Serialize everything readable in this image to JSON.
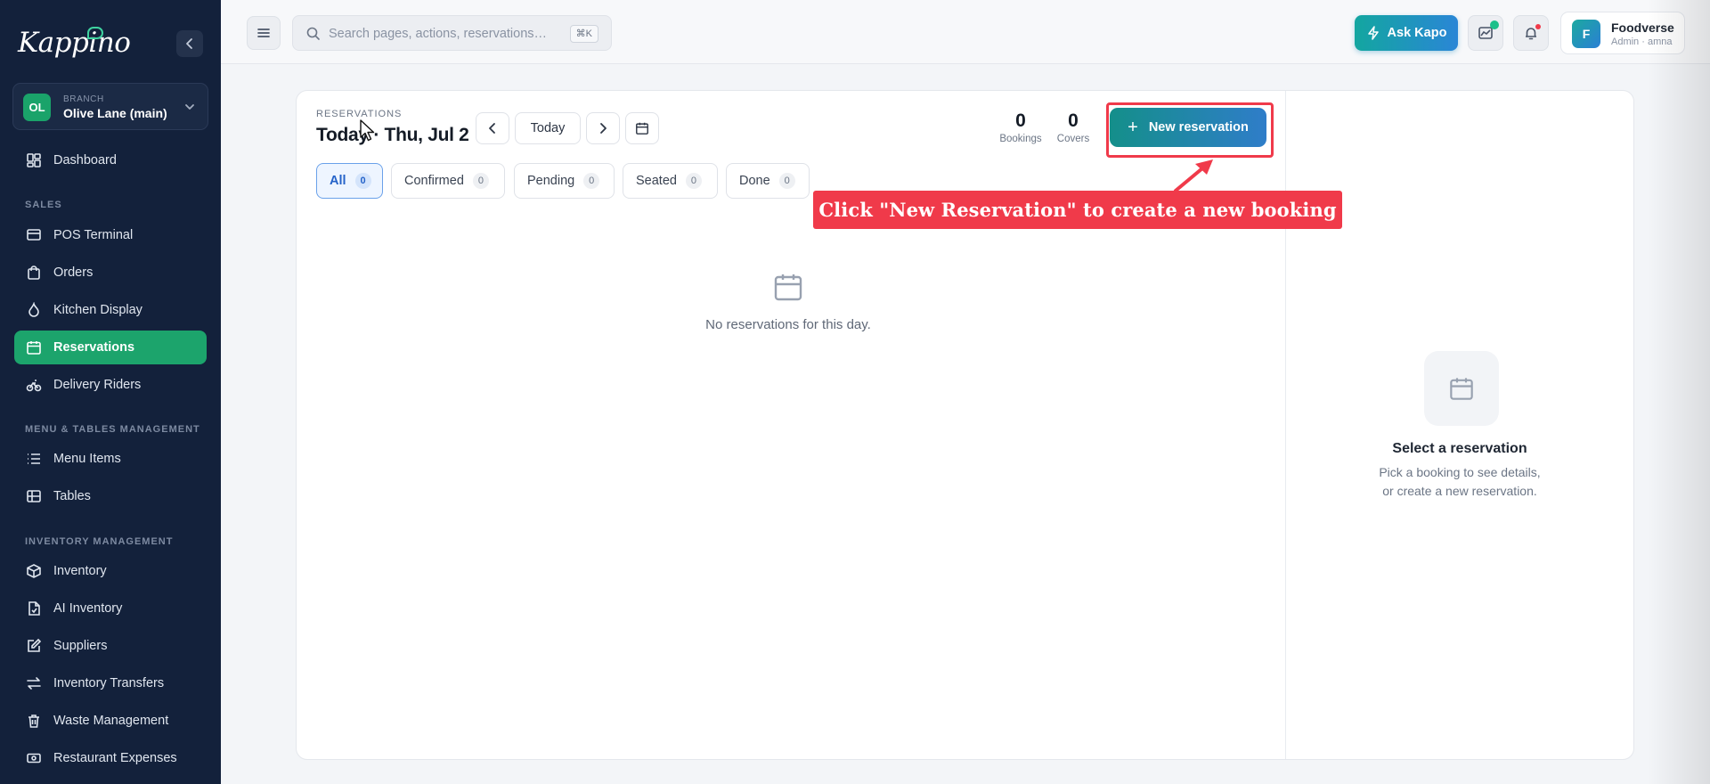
{
  "sidebar": {
    "logo": "Kappino",
    "branch": {
      "caption": "BRANCH",
      "initials": "OL",
      "name": "Olive Lane (main)"
    },
    "dashboard": "Dashboard",
    "sections": {
      "sales": "SALES",
      "menu": "MENU & TABLES MANAGEMENT",
      "inventory": "INVENTORY MANAGEMENT"
    },
    "items": {
      "pos": "POS Terminal",
      "orders": "Orders",
      "kitchen": "Kitchen Display",
      "reservations": "Reservations",
      "delivery": "Delivery Riders",
      "menu_items": "Menu Items",
      "tables": "Tables",
      "inventory": "Inventory",
      "ai_inventory": "AI Inventory",
      "suppliers": "Suppliers",
      "transfers": "Inventory Transfers",
      "waste": "Waste Management",
      "expenses": "Restaurant Expenses"
    }
  },
  "topbar": {
    "search_placeholder": "Search pages, actions, reservations…",
    "shortcut": "⌘K",
    "ask_label": "Ask Kapo",
    "profile": {
      "initial": "F",
      "name": "Foodverse",
      "role": "Admin · amna"
    }
  },
  "reservations": {
    "caption": "RESERVATIONS",
    "title": "Today · Thu, Jul 2",
    "today_label": "Today",
    "stats": {
      "bookings": "0",
      "bookings_label": "Bookings",
      "covers": "0",
      "covers_label": "Covers"
    },
    "new_button": "New reservation",
    "filters": [
      {
        "label": "All",
        "count": "0"
      },
      {
        "label": "Confirmed",
        "count": "0"
      },
      {
        "label": "Pending",
        "count": "0"
      },
      {
        "label": "Seated",
        "count": "0"
      },
      {
        "label": "Done",
        "count": "0"
      }
    ],
    "empty_text": "No reservations for this day.",
    "detail": {
      "title": "Select a reservation",
      "line1": "Pick a booking to see details,",
      "line2": "or create a new reservation."
    }
  },
  "annotation": "Click \"New Reservation\" to create a new booking",
  "colors": {
    "sidebar_bg": "#13213b",
    "accent_green": "#1ca46c",
    "highlight_red": "#f03a4a",
    "button_gradient_start": "#148f8a",
    "button_gradient_end": "#2f7dc9"
  }
}
